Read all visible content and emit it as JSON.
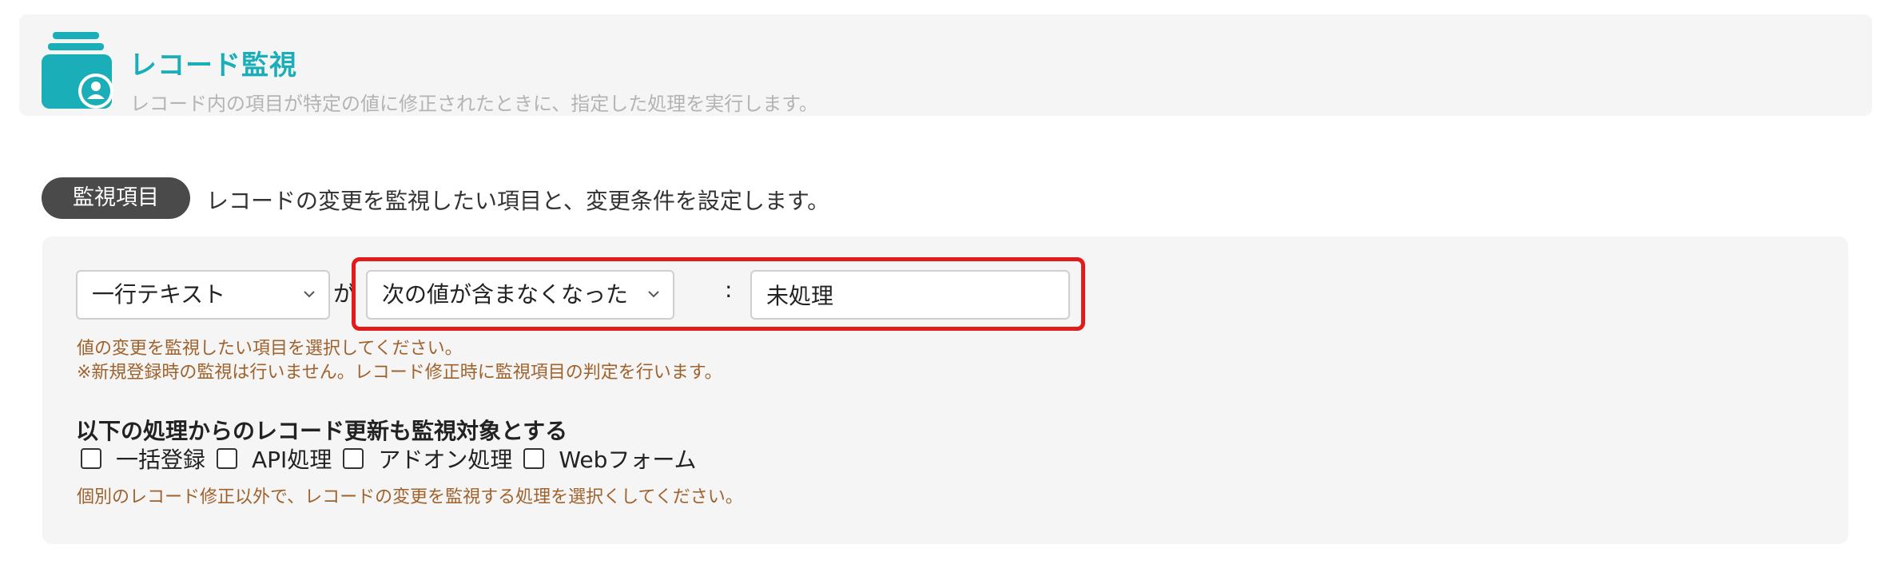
{
  "header": {
    "icon": "record-monitor-icon",
    "title": "レコード監視",
    "description": "レコード内の項目が特定の値に修正されたときに、指定した処理を実行します。"
  },
  "section": {
    "badge": "監視項目",
    "description": "レコードの変更を監視したい項目と、変更条件を設定します。"
  },
  "condition": {
    "field_select": "一行テキスト",
    "ga": "が",
    "operator_select": "次の値が含まなくなった",
    "colon": ":",
    "value": "未処理"
  },
  "help": {
    "line1": "値の変更を監視したい項目を選択してください。",
    "line2": "※新規登録時の監視は行いません。レコード修正時に監視項目の判定を行います。",
    "line3": "個別のレコード修正以外で、レコードの変更を監視する処理を選択くしてください。"
  },
  "sources": {
    "title": "以下の処理からのレコード更新も監視対象とする",
    "options": [
      {
        "label": "一括登録",
        "checked": false
      },
      {
        "label": "API処理",
        "checked": false
      },
      {
        "label": "アドオン処理",
        "checked": false
      },
      {
        "label": "Webフォーム",
        "checked": false
      }
    ]
  },
  "colors": {
    "accent": "#1aaeb8",
    "highlight": "#e11a1a",
    "help_text": "#a0622c",
    "badge_bg": "#4a4a4a"
  }
}
